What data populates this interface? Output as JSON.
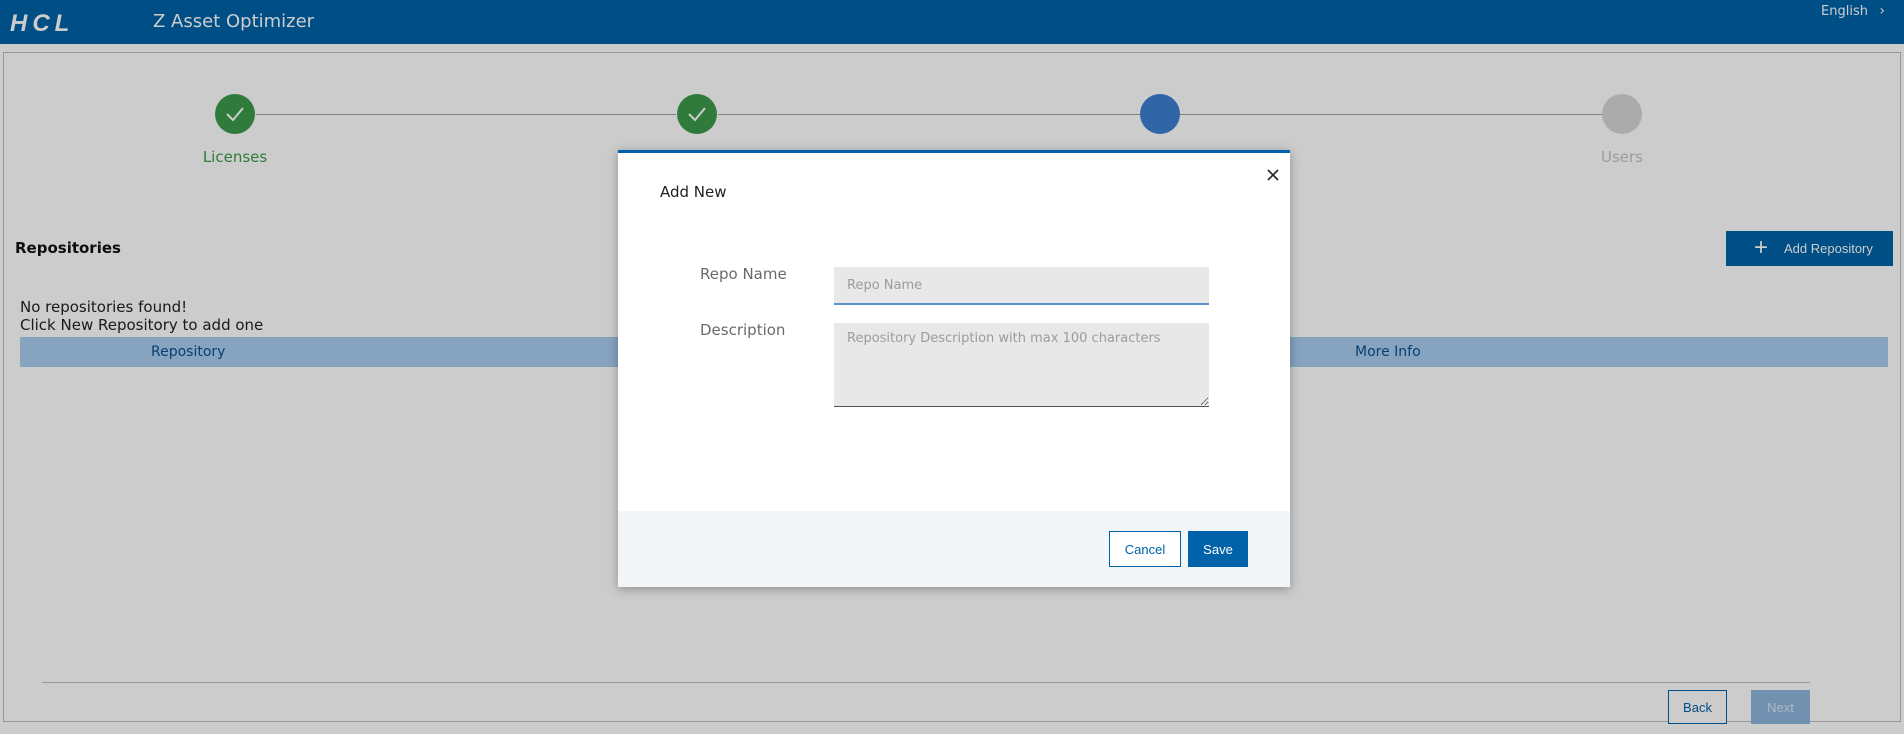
{
  "header": {
    "logo_text": "HCL",
    "app_title": "Z Asset Optimizer",
    "language": "English",
    "background_color": "#0062a8"
  },
  "stepper": {
    "steps": [
      {
        "label": "Licenses",
        "status": "complete"
      },
      {
        "label": "",
        "status": "complete"
      },
      {
        "label": "",
        "status": "active"
      },
      {
        "label": "Users",
        "status": "pending"
      }
    ],
    "colors": {
      "complete": "#3c9a4c",
      "active": "#3d7fd1",
      "pending": "#d6d6d6"
    }
  },
  "repositories": {
    "title": "Repositories",
    "add_button_label": "Add Repository",
    "empty_message_line1": "No repositories found!",
    "empty_message_line2": "Click New Repository to add one",
    "columns": [
      "Repository",
      "More Info"
    ]
  },
  "footer": {
    "back_label": "Back",
    "next_label": "Next"
  },
  "modal": {
    "title": "Add New",
    "repo_name_label": "Repo Name",
    "repo_name_placeholder": "Repo Name",
    "repo_name_value": "",
    "description_label": "Description",
    "description_placeholder": "Repository Description with max 100 characters",
    "description_value": "",
    "cancel_label": "Cancel",
    "save_label": "Save"
  }
}
